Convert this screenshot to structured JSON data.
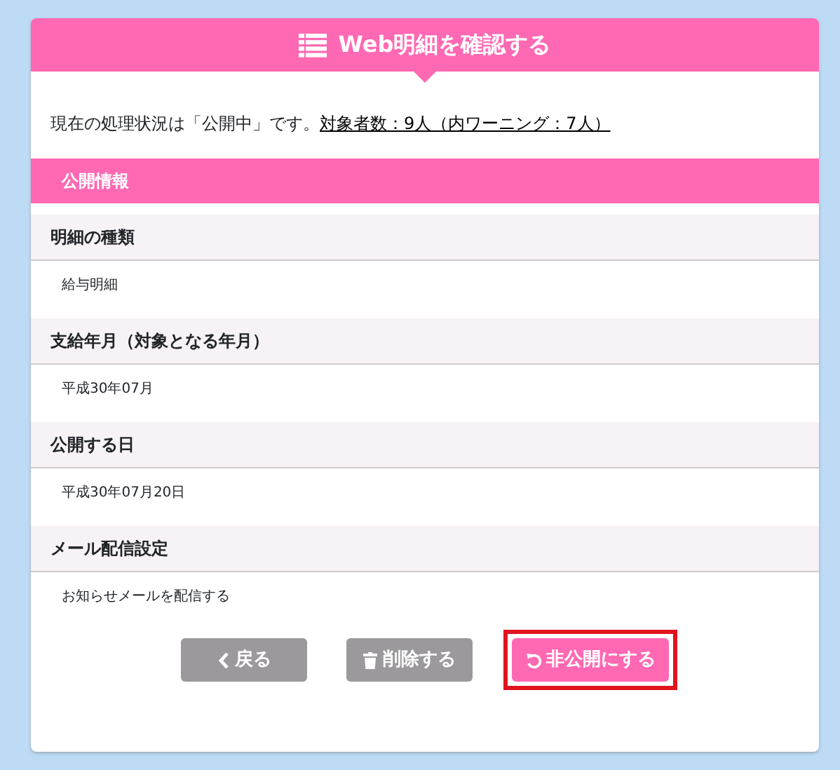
{
  "title": "Web明細を確認する",
  "status": {
    "text": "現在の処理状況は「公開中」です。",
    "link": "対象者数：9人（内ワーニング：7人）"
  },
  "section": "公開情報",
  "fields": [
    {
      "label": "明細の種類",
      "value": "給与明細"
    },
    {
      "label": "支給年月（対象となる年月）",
      "value": "平成30年07月"
    },
    {
      "label": "公開する日",
      "value": "平成30年07月20日"
    },
    {
      "label": "メール配信設定",
      "value": "お知らせメールを配信する"
    }
  ],
  "buttons": [
    {
      "kind": "back",
      "label": "戻る",
      "highlighted": false
    },
    {
      "kind": "delete",
      "label": "削除する",
      "highlighted": false
    },
    {
      "kind": "unpublish",
      "label": "非公開にする",
      "highlighted": true
    }
  ]
}
